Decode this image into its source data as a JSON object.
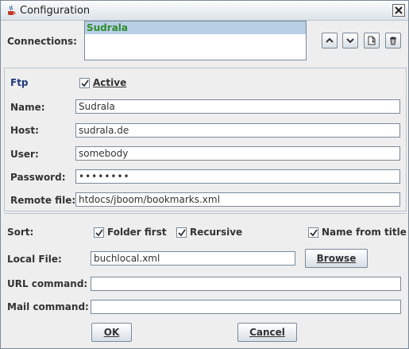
{
  "window": {
    "title": "Configuration"
  },
  "connections": {
    "label": "Connections:",
    "items": [
      "Sudrala"
    ]
  },
  "ftp": {
    "section_label": "Ftp",
    "active_label": "Active",
    "active_checked": true,
    "name_label": "Name:",
    "name_value": "Sudrala",
    "host_label": "Host:",
    "host_value": "sudrala.de",
    "user_label": "User:",
    "user_value": "somebody",
    "password_label": "Password:",
    "password_masked": "••••••••",
    "remote_file_label": "Remote file:",
    "remote_file_value": "htdocs/jboom/bookmarks.xml"
  },
  "sort": {
    "label": "Sort:",
    "folder_first_label": "Folder first",
    "folder_first_checked": true,
    "recursive_label": "Recursive",
    "recursive_checked": true,
    "name_from_title_label": "Name from title",
    "name_from_title_checked": true
  },
  "local_file": {
    "label": "Local File:",
    "value": "buchlocal.xml",
    "browse_label": "Browse"
  },
  "url_command": {
    "label": "URL command:",
    "value": ""
  },
  "mail_command": {
    "label": "Mail command:",
    "value": ""
  },
  "buttons": {
    "ok_label": "OK",
    "cancel_label": "Cancel"
  },
  "icons": {
    "app": "java-cup-icon",
    "close": "close-icon",
    "move_up": "chevron-up-icon",
    "move_down": "chevron-down-icon",
    "new": "new-document-icon",
    "delete": "trash-icon",
    "check": "checkmark-icon"
  }
}
